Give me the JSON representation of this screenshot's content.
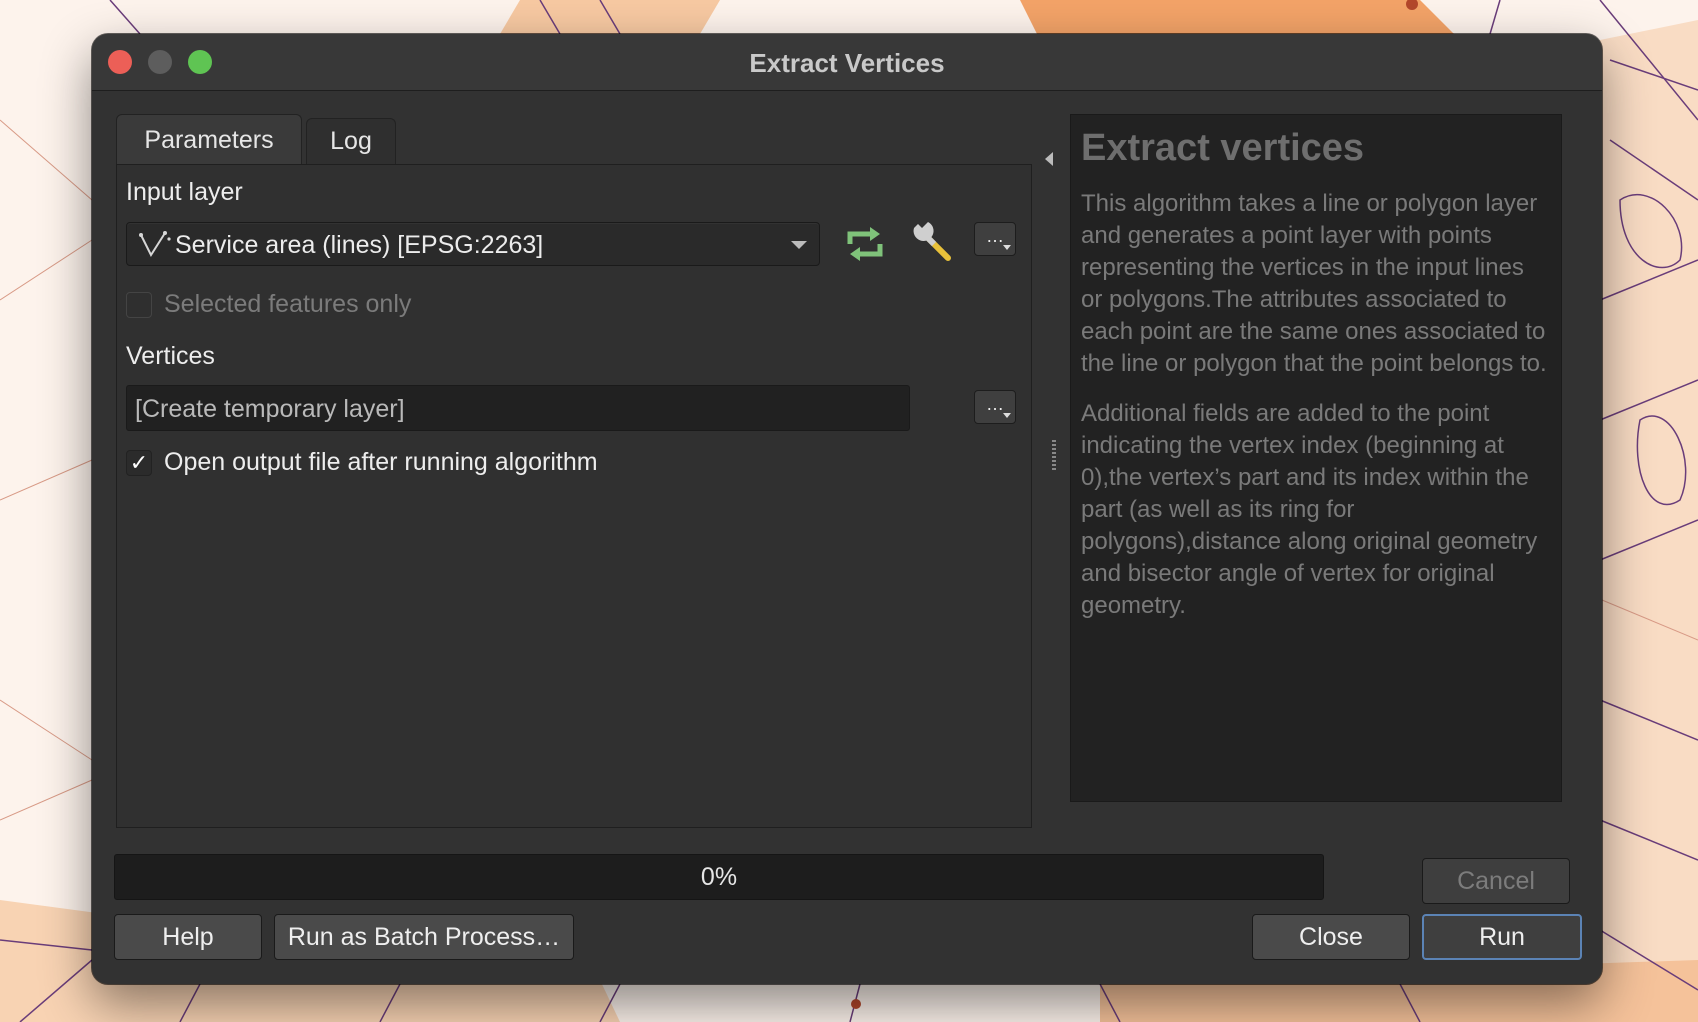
{
  "window": {
    "title": "Extract Vertices"
  },
  "tabs": [
    {
      "label": "Parameters",
      "active": true
    },
    {
      "label": "Log",
      "active": false
    }
  ],
  "params": {
    "input_layer_label": "Input layer",
    "input_layer_value": "Service area (lines) [EPSG:2263]",
    "selected_only_label": "Selected features only",
    "selected_only_checked": false,
    "vertices_label": "Vertices",
    "vertices_value": "[Create temporary layer]",
    "open_output_label": "Open output file after running algorithm",
    "open_output_checked": true,
    "browse_label": "…",
    "check_mark": "✓"
  },
  "help": {
    "title": "Extract vertices",
    "paragraphs": [
      "This algorithm takes a line or polygon layer and generates a point layer with points representing the vertices in the input lines or polygons.The attributes associated to each point are the same ones associated to the line or polygon that the point belongs to.",
      "Additional fields are added to the point indicating the vertex index (beginning at 0),the vertex’s part and its index within the part (as well as its ring for polygons),distance along original geometry and bisector angle of vertex for original geometry."
    ]
  },
  "progress": {
    "text": "0%",
    "value": 0
  },
  "buttons": {
    "cancel": "Cancel",
    "help": "Help",
    "batch": "Run as Batch Process…",
    "close": "Close",
    "run": "Run"
  },
  "icons": {
    "layer_type": "line-layer-icon",
    "iterate": "iterate-icon",
    "wrench": "wrench-icon"
  },
  "colors": {
    "accent": "#5b83b5",
    "close_light": "#ec5f57",
    "minimize_light": "#5d5d5d",
    "maximize_light": "#5fc453",
    "iterate_icon": "#7fc27a"
  }
}
